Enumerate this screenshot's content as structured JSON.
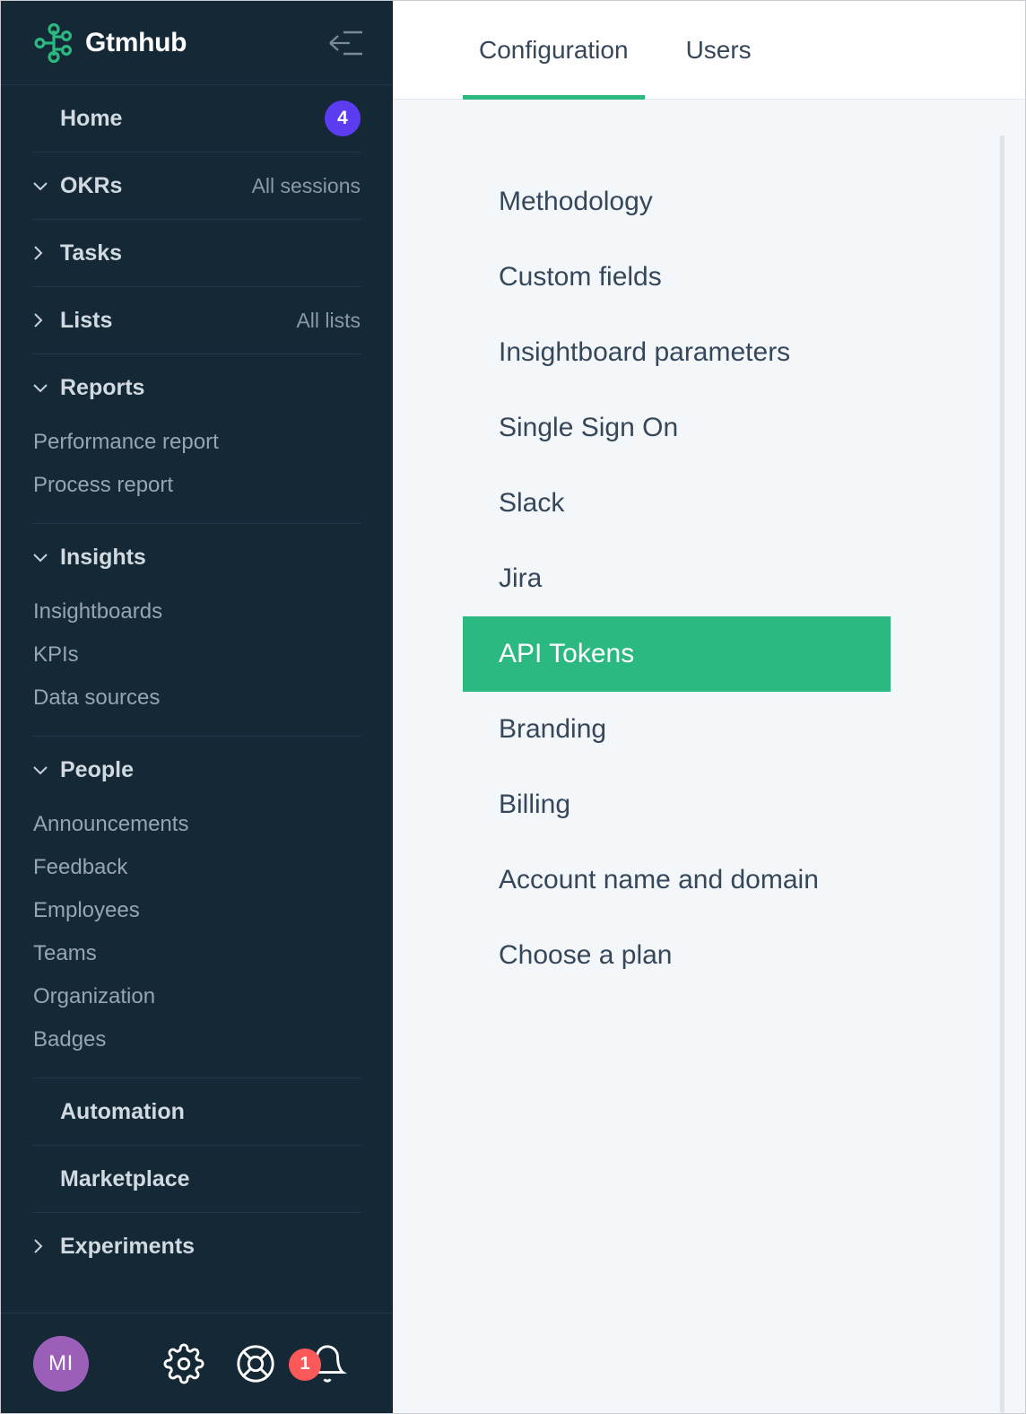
{
  "sidebar": {
    "brand": {
      "name": "Gtmhub",
      "logo_icon": "node-graph-icon",
      "accent_color": "#2BB881"
    },
    "collapse_icon": "collapse-sidebar-icon",
    "groups": [
      {
        "label": "Home",
        "arrow": "none",
        "badge": "4",
        "badge_color": "#5B3CF0",
        "children": []
      },
      {
        "label": "OKRs",
        "arrow": "down",
        "right_label": "All sessions",
        "children": []
      },
      {
        "label": "Tasks",
        "arrow": "right",
        "children": []
      },
      {
        "label": "Lists",
        "arrow": "right",
        "right_label": "All lists",
        "children": []
      },
      {
        "label": "Reports",
        "arrow": "down",
        "children": [
          "Performance report",
          "Process report"
        ]
      },
      {
        "label": "Insights",
        "arrow": "down",
        "children": [
          "Insightboards",
          "KPIs",
          "Data sources"
        ]
      },
      {
        "label": "People",
        "arrow": "down",
        "children": [
          "Announcements",
          "Feedback",
          "Employees",
          "Teams",
          "Organization",
          "Badges"
        ]
      },
      {
        "label": "Automation",
        "arrow": "none",
        "children": []
      },
      {
        "label": "Marketplace",
        "arrow": "none",
        "children": []
      },
      {
        "label": "Experiments",
        "arrow": "right",
        "children": []
      }
    ],
    "footer": {
      "avatar_initials": "MI",
      "avatar_color": "#9B5FB9",
      "settings_icon": "gear-icon",
      "help_icon": "lifebuoy-icon",
      "notifications_icon": "bell-icon",
      "notifications_count": "1",
      "notifications_badge_color": "#FB5959"
    }
  },
  "main": {
    "tabs": [
      {
        "label": "Configuration",
        "active": true
      },
      {
        "label": "Users",
        "active": false
      }
    ],
    "active_tab_underline_color": "#2BB881",
    "config_items": [
      {
        "label": "Methodology",
        "selected": false
      },
      {
        "label": "Custom fields",
        "selected": false
      },
      {
        "label": "Insightboard parameters",
        "selected": false
      },
      {
        "label": "Single Sign On",
        "selected": false
      },
      {
        "label": "Slack",
        "selected": false
      },
      {
        "label": "Jira",
        "selected": false
      },
      {
        "label": "API Tokens",
        "selected": true
      },
      {
        "label": "Branding",
        "selected": false
      },
      {
        "label": "Billing",
        "selected": false
      },
      {
        "label": "Account name and domain",
        "selected": false
      },
      {
        "label": "Choose a plan",
        "selected": false
      }
    ],
    "selected_item_color": "#2BB881"
  }
}
